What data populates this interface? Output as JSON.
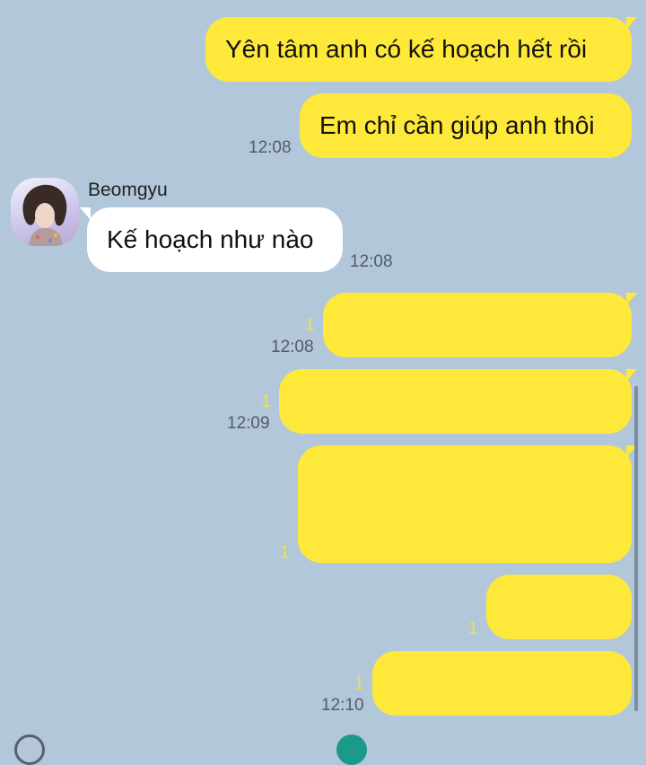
{
  "chat": {
    "contact_name": "Beomgyu",
    "messages": [
      {
        "text": "Yên tâm anh có kế hoạch hết rồi",
        "direction": "outgoing"
      },
      {
        "text": "Em chỉ cần giúp anh thôi",
        "direction": "outgoing",
        "time": "12:08"
      },
      {
        "text": "Kế hoạch như nào",
        "direction": "incoming",
        "time": "12:08"
      },
      {
        "text": "",
        "direction": "outgoing",
        "unread": "1",
        "time": "12:08"
      },
      {
        "text": "",
        "direction": "outgoing",
        "unread": "1",
        "time": "12:09"
      },
      {
        "text": "",
        "direction": "outgoing",
        "unread": "1"
      },
      {
        "text": "",
        "direction": "outgoing",
        "unread": "1"
      },
      {
        "text": "",
        "direction": "outgoing",
        "unread": "1",
        "time": "12:10"
      }
    ]
  },
  "colors": {
    "background": "#b2c7da",
    "outgoing_bubble": "#fee93a",
    "incoming_bubble": "#ffffff",
    "unread_count": "#f2e14a"
  }
}
